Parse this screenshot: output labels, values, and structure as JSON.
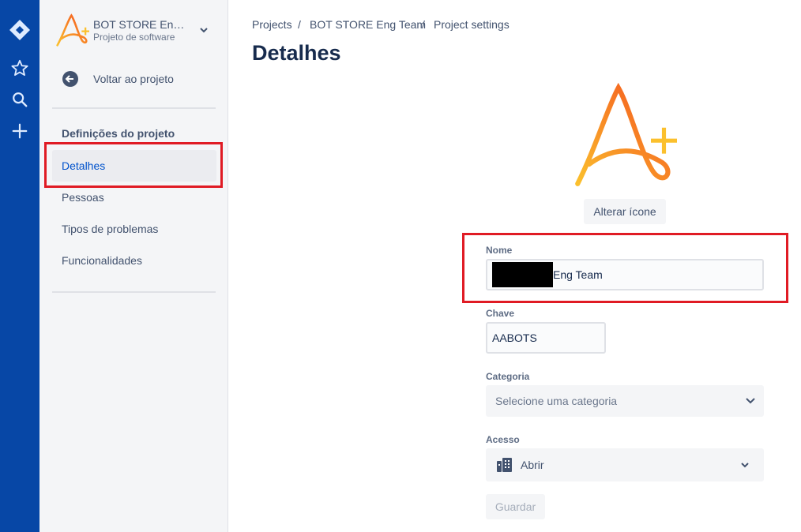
{
  "colors": {
    "global_nav": "#0747a6",
    "sidebar_bg": "#f4f5f7",
    "accent": "#0052cc",
    "highlight_box": "#e01b24",
    "logo_gradient": [
      "#fbc02d",
      "#f4511e"
    ]
  },
  "global_nav": {
    "icons": [
      "jira-logo-icon",
      "star-icon",
      "search-icon",
      "plus-icon"
    ]
  },
  "sidebar": {
    "project_name": "BOT STORE En…",
    "project_type": "Projeto de software",
    "back_label": "Voltar ao projeto",
    "section_title": "Definições do projeto",
    "items": [
      {
        "label": "Detalhes",
        "selected": true
      },
      {
        "label": "Pessoas"
      },
      {
        "label": "Tipos de problemas"
      },
      {
        "label": "Funcionalidades"
      }
    ]
  },
  "breadcrumb": [
    "Projects",
    "BOT STORE Eng Team",
    "Project settings"
  ],
  "page_title": "Detalhes",
  "form": {
    "change_icon_label": "Alterar ícone",
    "name_label": "Nome",
    "name_value": "Eng Team",
    "key_label": "Chave",
    "key_value": "AABOTS",
    "category_label": "Categoria",
    "category_placeholder": "Selecione uma categoria",
    "access_label": "Acesso",
    "access_value": "Abrir",
    "save_label": "Guardar"
  }
}
